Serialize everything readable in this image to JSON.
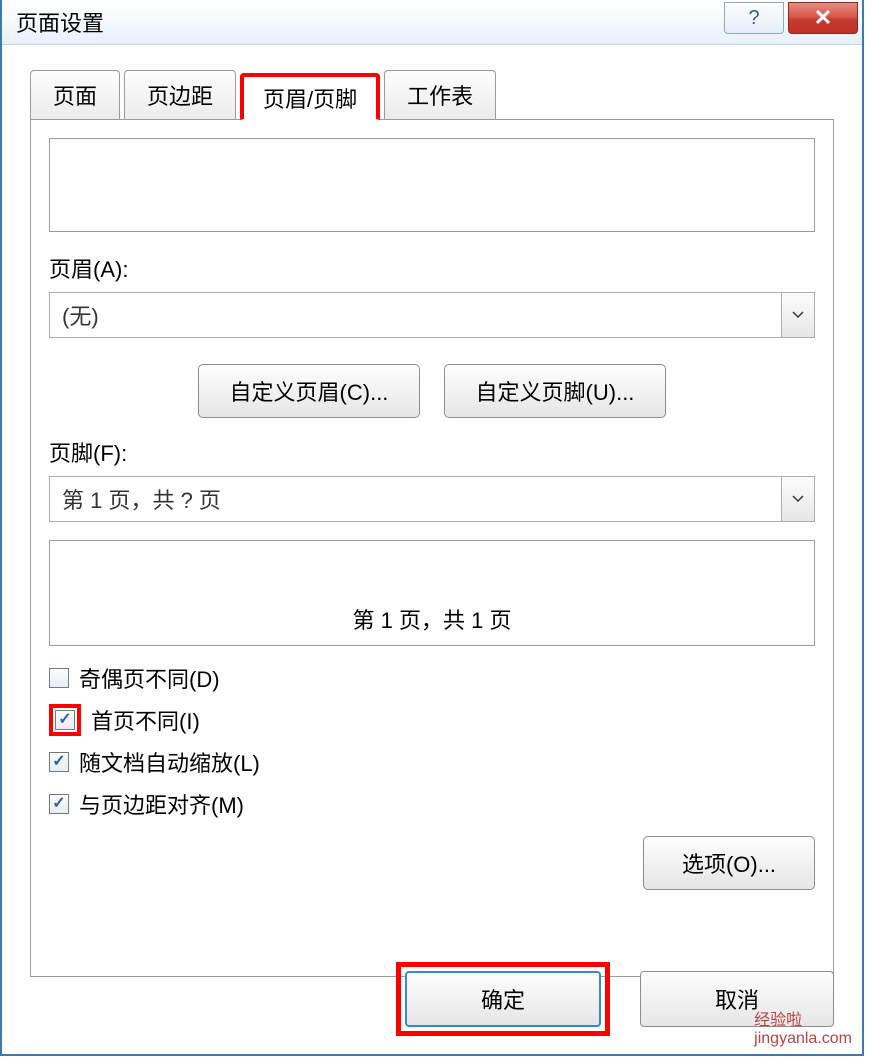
{
  "dialog": {
    "title": "页面设置"
  },
  "tabs": {
    "page": "页面",
    "margins": "页边距",
    "headerfooter": "页眉/页脚",
    "sheet": "工作表"
  },
  "labels": {
    "header": "页眉(A):",
    "footer": "页脚(F):"
  },
  "combos": {
    "header_value": "(无)",
    "footer_value": "第 1 页，共 ? 页"
  },
  "buttons": {
    "custom_header": "自定义页眉(C)...",
    "custom_footer": "自定义页脚(U)...",
    "options": "选项(O)...",
    "ok": "确定",
    "cancel": "取消"
  },
  "preview": {
    "footer_text": "第 1 页，共 1 页"
  },
  "checks": {
    "odd_even": "奇偶页不同(D)",
    "first_page": "首页不同(I)",
    "scale_with_doc": "随文档自动缩放(L)",
    "align_margins": "与页边距对齐(M)"
  },
  "watermark": {
    "site": "jingyanla.com",
    "brand": "经验啦"
  }
}
